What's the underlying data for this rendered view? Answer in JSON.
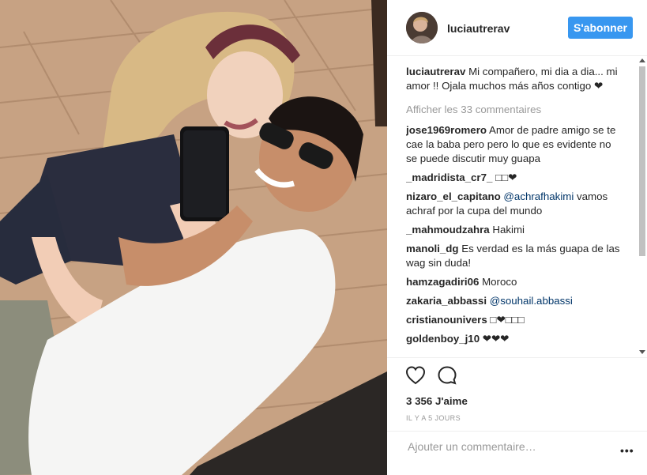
{
  "post": {
    "username": "luciautrerav",
    "follow_label": "S'abonner",
    "caption_user": "luciautrerav",
    "caption_text": " Mi compañero, mi dia a dia... mi amor !! Ojala muchos más años contigo ❤",
    "view_all": "Afficher les 33 commentaires",
    "likes": "3 356 J'aime",
    "time": "IL Y A 5 JOURS",
    "add_comment_placeholder": "Ajouter un commentaire…",
    "more_options": "•••"
  },
  "comments": [
    {
      "user": "jose1969romero",
      "text": " Amor de padre amigo se te cae la baba pero pero lo que es evidente no se puede discutir muy guapa"
    },
    {
      "user": "_madridista_cr7_",
      "text": " □□❤"
    },
    {
      "user": "nizaro_el_capitano",
      "mention": "@achrafhakimi",
      "text": " vamos achraf por la cupa del mundo"
    },
    {
      "user": "_mahmoudzahra",
      "text": " Hakimi"
    },
    {
      "user": "manoli_dg",
      "text": " Es verdad es la más guapa de las wag sin duda!"
    },
    {
      "user": "hamzagadiri06",
      "text": " Moroco"
    },
    {
      "user": "zakaria_abbassi",
      "mention": "@souhail.abbassi",
      "text": ""
    },
    {
      "user": "cristianounivers",
      "text": " □❤□□□"
    },
    {
      "user": "goldenboy_j10",
      "text": " ❤❤❤"
    }
  ],
  "icons": {
    "like": "heart-icon",
    "comment": "comment-icon",
    "scroll_up": "scroll-up-arrow",
    "scroll_down": "scroll-down-arrow"
  },
  "colors": {
    "accent": "#3897f0",
    "mention": "#003569",
    "muted": "#999999"
  }
}
